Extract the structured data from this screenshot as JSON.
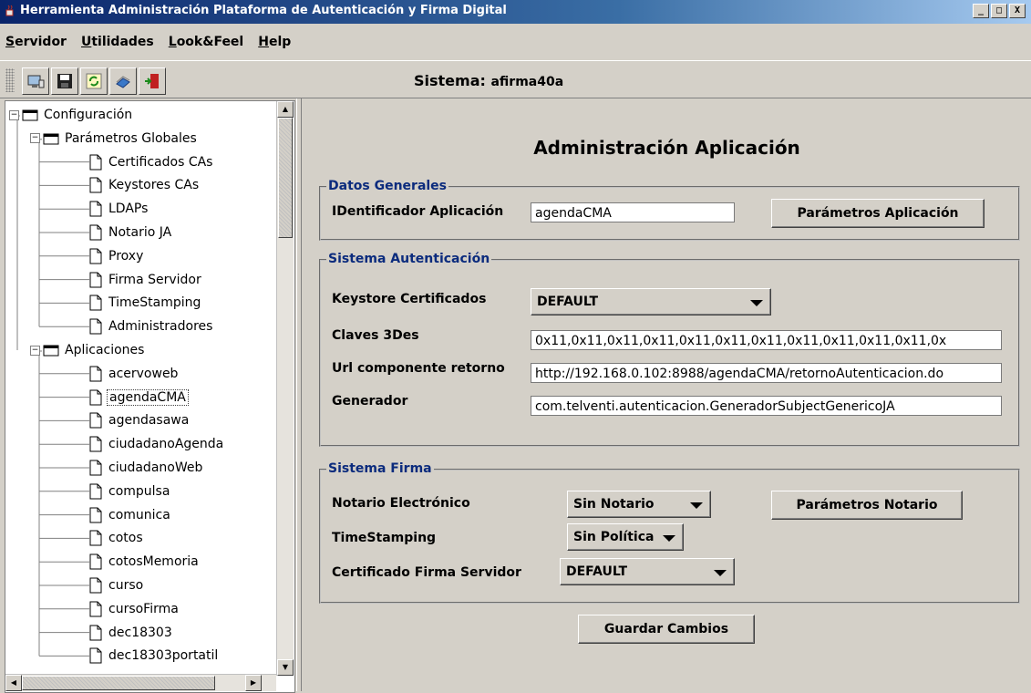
{
  "window": {
    "title": "Herramienta Administración Plataforma de Autenticación y Firma Digital",
    "controls": [
      "_",
      "□",
      "X"
    ]
  },
  "menu": [
    {
      "first": "S",
      "rest": "ervidor"
    },
    {
      "first": "U",
      "rest": "tilidades"
    },
    {
      "first": "L",
      "rest": "ook&Feel"
    },
    {
      "first": "H",
      "rest": "elp"
    }
  ],
  "toolbar": {
    "icons": [
      "monitor-icon",
      "save-icon",
      "refresh-icon",
      "book-icon",
      "exit-door-icon"
    ],
    "sistema_label": "Sistema:",
    "sistema_value": "afirma40a"
  },
  "tree": {
    "root": "Configuración",
    "globales": "Parámetros Globales",
    "global_items": [
      "Certificados CAs",
      "Keystores CAs",
      "LDAPs",
      "Notario JA",
      "Proxy",
      "Firma Servidor",
      "TimeStamping",
      "Administradores"
    ],
    "aplicaciones": "Aplicaciones",
    "app_items": [
      "acervoweb",
      "agendaCMA",
      "agendasawa",
      "ciudadanoAgenda",
      "ciudadanoWeb",
      "compulsa",
      "comunica",
      "cotos",
      "cotosMemoria",
      "curso",
      "cursoFirma",
      "dec18303",
      "dec18303portatil"
    ],
    "selected": "agendaCMA"
  },
  "main": {
    "title": "Administración Aplicación",
    "datos_generales": {
      "legend": "Datos Generales",
      "id_label": "IDentificador Aplicación",
      "id_value": "agendaCMA",
      "params_button": "Parámetros Aplicación"
    },
    "autenticacion": {
      "legend": "Sistema Autenticación",
      "keystore_label": "Keystore Certificados",
      "keystore_value": "DEFAULT",
      "claves_label": "Claves 3Des",
      "claves_value": "0x11,0x11,0x11,0x11,0x11,0x11,0x11,0x11,0x11,0x11,0x11,0x",
      "url_label": "Url componente retorno",
      "url_value": "http://192.168.0.102:8988/agendaCMA/retornoAutenticacion.do",
      "generador_label": "Generador",
      "generador_value": "com.telventi.autenticacion.GeneradorSubjectGenericoJA"
    },
    "firma": {
      "legend": "Sistema Firma",
      "notario_label": "Notario Electrónico",
      "notario_value": "Sin Notario",
      "notario_button": "Parámetros Notario",
      "timestamping_label": "TimeStamping",
      "timestamping_value": "Sin Política",
      "cert_label": "Certificado Firma Servidor",
      "cert_value": "DEFAULT"
    },
    "save_button": "Guardar Cambios"
  }
}
